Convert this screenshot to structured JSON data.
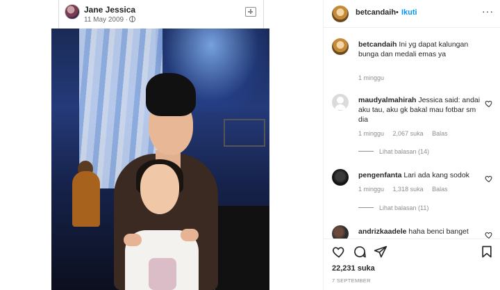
{
  "facebook_post": {
    "author": "Jane Jessica",
    "date": "11 May 2009 ·"
  },
  "post_owner": {
    "username": "betcandaih",
    "separator": "•",
    "follow_label": "Ikuti",
    "more_label": "···"
  },
  "caption": {
    "username": "betcandaih",
    "text": "Ini yg dapat kalungan bunga dan medali emas ya",
    "time": "1 minggu"
  },
  "comments": [
    {
      "username": "maudyalmahirah",
      "text": "Jessica said: andai aku tau, aku gk bakal mau fotbar sm dia",
      "time": "1 minggu",
      "likes": "2,067 suka",
      "reply_label": "Balas",
      "view_replies": "Lihat balasan (14)"
    },
    {
      "username": "pengenfanta",
      "text": "Lari ada kang sodok",
      "time": "1 minggu",
      "likes": "1,318 suka",
      "reply_label": "Balas",
      "view_replies": "Lihat balasan (11)"
    },
    {
      "username": "andrizkaadele",
      "text": "haha benci banget"
    }
  ],
  "like_count": "22,231 suka",
  "post_date": "7 SEPTEMBER",
  "icons": {
    "like": "heart-icon",
    "comment": "comment-icon",
    "share": "share-icon",
    "save": "save-post-icon",
    "more": "more-options-icon"
  }
}
